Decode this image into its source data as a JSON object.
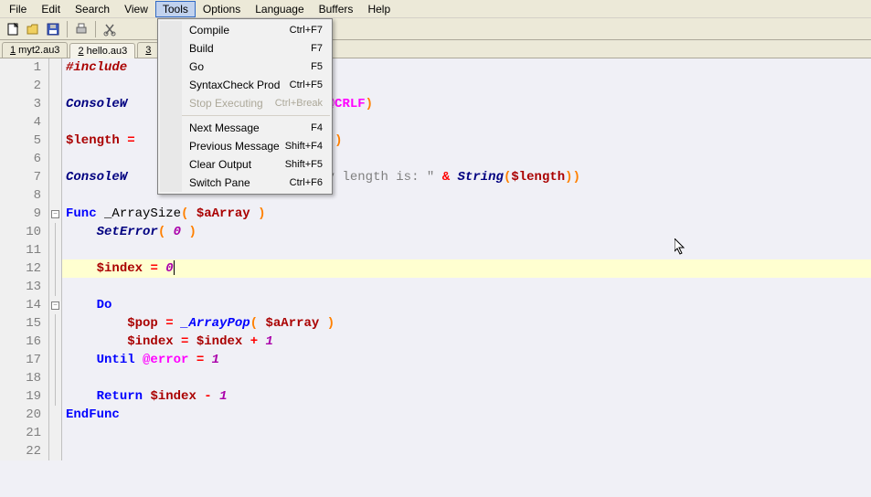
{
  "menubar": {
    "items": [
      "File",
      "Edit",
      "Search",
      "View",
      "Tools",
      "Options",
      "Language",
      "Buffers",
      "Help"
    ],
    "active_index": 4
  },
  "tabs": [
    {
      "num": "1",
      "label": "myt2.au3"
    },
    {
      "num": "2",
      "label": "hello.au3"
    },
    {
      "num": "3",
      "label": ""
    }
  ],
  "active_tab": 1,
  "dropdown": {
    "groups": [
      [
        {
          "label": "Compile",
          "shortcut": "Ctrl+F7"
        },
        {
          "label": "Build",
          "shortcut": "F7"
        },
        {
          "label": "Go",
          "shortcut": "F5"
        },
        {
          "label": "SyntaxCheck Prod",
          "shortcut": "Ctrl+F5"
        },
        {
          "label": "Stop Executing",
          "shortcut": "Ctrl+Break",
          "disabled": true
        }
      ],
      [
        {
          "label": "Next Message",
          "shortcut": "F4"
        },
        {
          "label": "Previous Message",
          "shortcut": "Shift+F4"
        },
        {
          "label": "Clear Output",
          "shortcut": "Shift+F5"
        },
        {
          "label": "Switch Pane",
          "shortcut": "Ctrl+F6"
        }
      ]
    ]
  },
  "code": {
    "lines": [
      {
        "n": 1,
        "tokens": [
          {
            "c": "kw-red",
            "t": "#include"
          }
        ]
      },
      {
        "n": 2,
        "tokens": []
      },
      {
        "n": 3,
        "tokens": [
          {
            "c": "func",
            "t": "ConsoleW"
          },
          {
            "c": "",
            "t": "                          "
          },
          {
            "c": "macro",
            "t": "@CRLF"
          },
          {
            "c": "paren",
            "t": ")"
          }
        ]
      },
      {
        "n": 4,
        "tokens": []
      },
      {
        "n": 5,
        "tokens": [
          {
            "c": "var",
            "t": "$length"
          },
          {
            "c": "",
            "t": " "
          },
          {
            "c": "op",
            "t": "="
          },
          {
            "c": "",
            "t": "                          "
          },
          {
            "c": "paren",
            "t": ")"
          }
        ]
      },
      {
        "n": 6,
        "tokens": []
      },
      {
        "n": 7,
        "tokens": [
          {
            "c": "func",
            "t": "ConsoleW"
          },
          {
            "c": "",
            "t": "                         "
          },
          {
            "c": "str",
            "t": "ay length is: \""
          },
          {
            "c": "",
            "t": " "
          },
          {
            "c": "op",
            "t": "&"
          },
          {
            "c": "",
            "t": " "
          },
          {
            "c": "func",
            "t": "String"
          },
          {
            "c": "paren",
            "t": "("
          },
          {
            "c": "var",
            "t": "$length"
          },
          {
            "c": "paren",
            "t": ")"
          },
          {
            "c": "paren",
            "t": ")"
          }
        ]
      },
      {
        "n": 8,
        "tokens": []
      },
      {
        "n": 9,
        "fold": "minus",
        "tokens": [
          {
            "c": "kw-blue",
            "t": "Func"
          },
          {
            "c": "",
            "t": " _ArraySize"
          },
          {
            "c": "paren",
            "t": "("
          },
          {
            "c": "",
            "t": " "
          },
          {
            "c": "var",
            "t": "$aArray"
          },
          {
            "c": "",
            "t": " "
          },
          {
            "c": "paren",
            "t": ")"
          }
        ]
      },
      {
        "n": 10,
        "foldline": true,
        "tokens": [
          {
            "c": "",
            "t": "    "
          },
          {
            "c": "func",
            "t": "SetError"
          },
          {
            "c": "paren",
            "t": "("
          },
          {
            "c": "",
            "t": " "
          },
          {
            "c": "num",
            "t": "0"
          },
          {
            "c": "",
            "t": " "
          },
          {
            "c": "paren",
            "t": ")"
          }
        ]
      },
      {
        "n": 11,
        "foldline": true,
        "tokens": []
      },
      {
        "n": 12,
        "foldline": true,
        "current": true,
        "tokens": [
          {
            "c": "",
            "t": "    "
          },
          {
            "c": "var",
            "t": "$index"
          },
          {
            "c": "",
            "t": " "
          },
          {
            "c": "op",
            "t": "="
          },
          {
            "c": "",
            "t": " "
          },
          {
            "c": "num",
            "t": "0"
          }
        ],
        "caret": true
      },
      {
        "n": 13,
        "foldline": true,
        "tokens": []
      },
      {
        "n": 14,
        "fold": "minus",
        "tokens": [
          {
            "c": "",
            "t": "    "
          },
          {
            "c": "kw-blue",
            "t": "Do"
          }
        ]
      },
      {
        "n": 15,
        "foldline": true,
        "tokens": [
          {
            "c": "",
            "t": "        "
          },
          {
            "c": "var",
            "t": "$pop"
          },
          {
            "c": "",
            "t": " "
          },
          {
            "c": "op",
            "t": "="
          },
          {
            "c": "",
            "t": " "
          },
          {
            "c": "kw-blueit",
            "t": "_ArrayPop"
          },
          {
            "c": "paren",
            "t": "("
          },
          {
            "c": "",
            "t": " "
          },
          {
            "c": "var",
            "t": "$aArray"
          },
          {
            "c": "",
            "t": " "
          },
          {
            "c": "paren",
            "t": ")"
          }
        ]
      },
      {
        "n": 16,
        "foldline": true,
        "tokens": [
          {
            "c": "",
            "t": "        "
          },
          {
            "c": "var",
            "t": "$index"
          },
          {
            "c": "",
            "t": " "
          },
          {
            "c": "op",
            "t": "="
          },
          {
            "c": "",
            "t": " "
          },
          {
            "c": "var",
            "t": "$index"
          },
          {
            "c": "",
            "t": " "
          },
          {
            "c": "op",
            "t": "+"
          },
          {
            "c": "",
            "t": " "
          },
          {
            "c": "num",
            "t": "1"
          }
        ]
      },
      {
        "n": 17,
        "foldline": true,
        "tokens": [
          {
            "c": "",
            "t": "    "
          },
          {
            "c": "kw-blue",
            "t": "Until"
          },
          {
            "c": "",
            "t": " "
          },
          {
            "c": "macro",
            "t": "@error"
          },
          {
            "c": "",
            "t": " "
          },
          {
            "c": "op",
            "t": "="
          },
          {
            "c": "",
            "t": " "
          },
          {
            "c": "num",
            "t": "1"
          }
        ]
      },
      {
        "n": 18,
        "foldline": true,
        "tokens": []
      },
      {
        "n": 19,
        "foldline": true,
        "tokens": [
          {
            "c": "",
            "t": "    "
          },
          {
            "c": "kw-blue",
            "t": "Return"
          },
          {
            "c": "",
            "t": " "
          },
          {
            "c": "var",
            "t": "$index"
          },
          {
            "c": "",
            "t": " "
          },
          {
            "c": "op",
            "t": "-"
          },
          {
            "c": "",
            "t": " "
          },
          {
            "c": "num",
            "t": "1"
          }
        ]
      },
      {
        "n": 20,
        "tokens": [
          {
            "c": "kw-blue",
            "t": "EndFunc"
          }
        ]
      },
      {
        "n": 21,
        "tokens": []
      },
      {
        "n": 22,
        "tokens": []
      }
    ]
  }
}
